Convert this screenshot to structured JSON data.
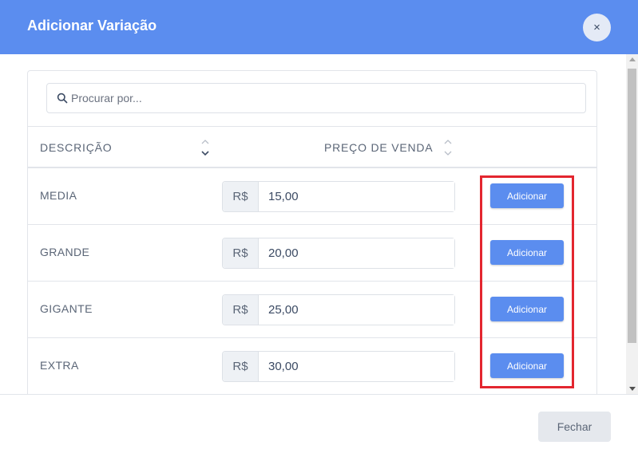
{
  "modal": {
    "title": "Adicionar Variação",
    "close_glyph": "×"
  },
  "search": {
    "placeholder": "Procurar por...",
    "value": ""
  },
  "table": {
    "columns": [
      "DESCRIÇÃO",
      "PREÇO DE VENDA"
    ],
    "currency_prefix": "R$",
    "add_label": "Adicionar",
    "rows": [
      {
        "description": "MEDIA",
        "price": "15,00"
      },
      {
        "description": "GRANDE",
        "price": "20,00"
      },
      {
        "description": "GIGANTE",
        "price": "25,00"
      },
      {
        "description": "EXTRA",
        "price": "30,00"
      }
    ]
  },
  "footer": {
    "close_label": "Fechar"
  },
  "colors": {
    "header": "#5b8def",
    "button": "#5b8def",
    "highlight": "#e3262f"
  },
  "icons": [
    "close-icon",
    "search-icon",
    "sort-icon",
    "scroll-up-arrow",
    "scroll-down-arrow"
  ]
}
